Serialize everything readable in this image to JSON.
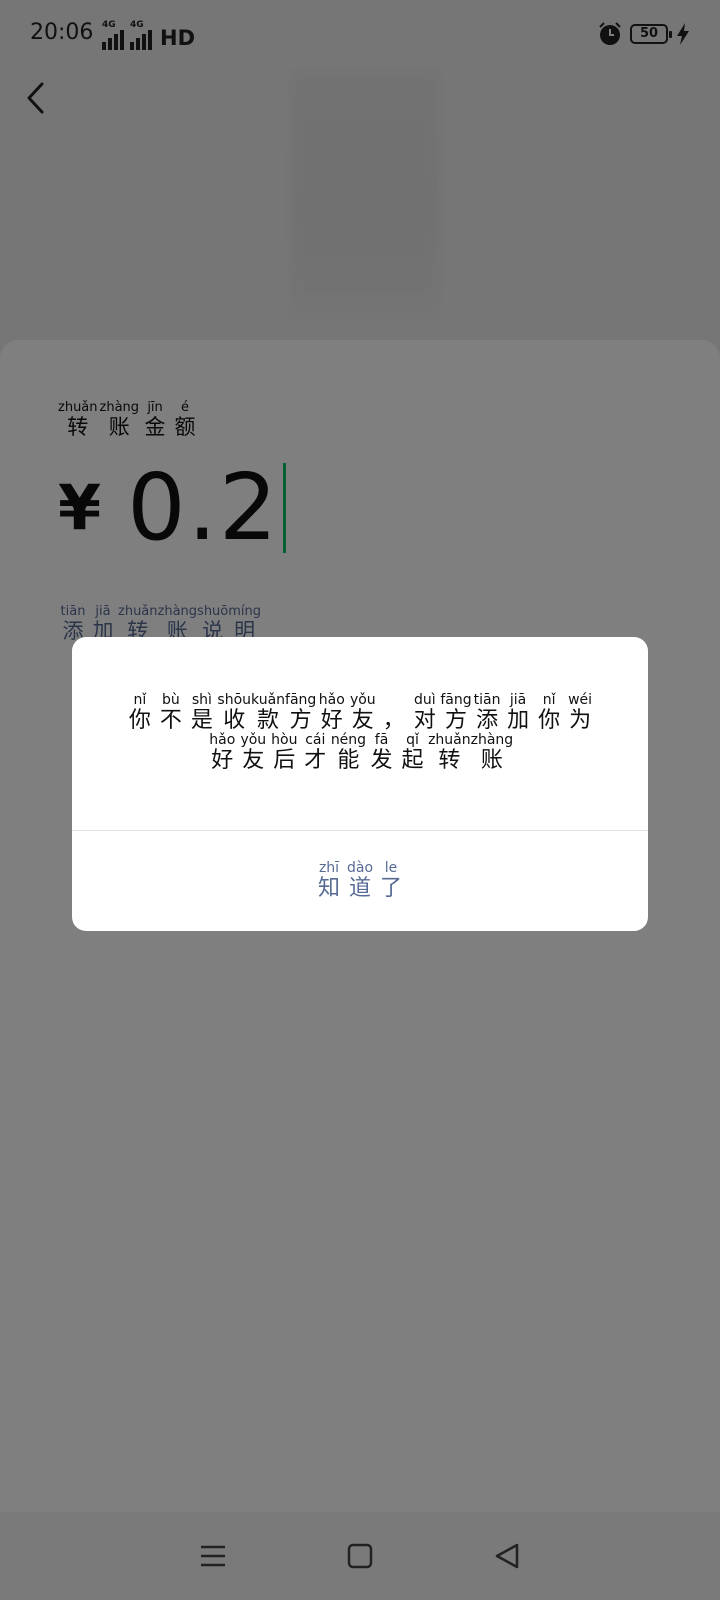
{
  "status_bar": {
    "time": "20:06",
    "network_1": "4G",
    "network_2": "4G",
    "hd": "HD",
    "battery": "50",
    "icons": [
      "alarm-icon",
      "charging-bolt-icon"
    ]
  },
  "header": {
    "back_icon": "chevron-left-icon"
  },
  "form": {
    "amount_label": [
      {
        "py": "zhuǎn",
        "hz": "转"
      },
      {
        "py": "zhàng",
        "hz": "账"
      },
      {
        "py": "jīn",
        "hz": "金"
      },
      {
        "py": "é",
        "hz": "额"
      }
    ],
    "currency": "¥",
    "amount": "0.2",
    "remark_link": [
      {
        "py": "tiān",
        "hz": "添"
      },
      {
        "py": "jiā",
        "hz": "加"
      },
      {
        "py": "zhuǎn",
        "hz": "转"
      },
      {
        "py": "zhàng",
        "hz": "账"
      },
      {
        "py": "shuō",
        "hz": "说"
      },
      {
        "py": "míng",
        "hz": "明"
      }
    ]
  },
  "dialog": {
    "line1": [
      {
        "py": "nǐ",
        "hz": "你"
      },
      {
        "py": "bù",
        "hz": "不"
      },
      {
        "py": "shì",
        "hz": "是"
      },
      {
        "py": "shōu",
        "hz": "收"
      },
      {
        "py": "kuǎn",
        "hz": "款"
      },
      {
        "py": "fāng",
        "hz": "方"
      },
      {
        "py": "hǎo",
        "hz": "好"
      },
      {
        "py": "yǒu",
        "hz": "友"
      },
      {
        "py": "",
        "hz": "，"
      },
      {
        "py": "duì",
        "hz": "对"
      },
      {
        "py": "fāng",
        "hz": "方"
      },
      {
        "py": "tiān",
        "hz": "添"
      },
      {
        "py": "jiā",
        "hz": "加"
      },
      {
        "py": "nǐ",
        "hz": "你"
      },
      {
        "py": "wéi",
        "hz": "为"
      }
    ],
    "line2": [
      {
        "py": "hǎo",
        "hz": "好"
      },
      {
        "py": "yǒu",
        "hz": "友"
      },
      {
        "py": "hòu",
        "hz": "后"
      },
      {
        "py": "cái",
        "hz": "才"
      },
      {
        "py": "néng",
        "hz": "能"
      },
      {
        "py": "fā",
        "hz": "发"
      },
      {
        "py": "qǐ",
        "hz": "起"
      },
      {
        "py": "zhuǎn",
        "hz": "转"
      },
      {
        "py": "zhàng",
        "hz": "账"
      }
    ],
    "ok_button": [
      {
        "py": "zhī",
        "hz": "知"
      },
      {
        "py": "dào",
        "hz": "道"
      },
      {
        "py": "le",
        "hz": "了"
      }
    ],
    "accent_color": "#576b95"
  },
  "nav_bar": {
    "icons": [
      "menu-icon",
      "home-icon",
      "back-triangle-icon"
    ]
  }
}
